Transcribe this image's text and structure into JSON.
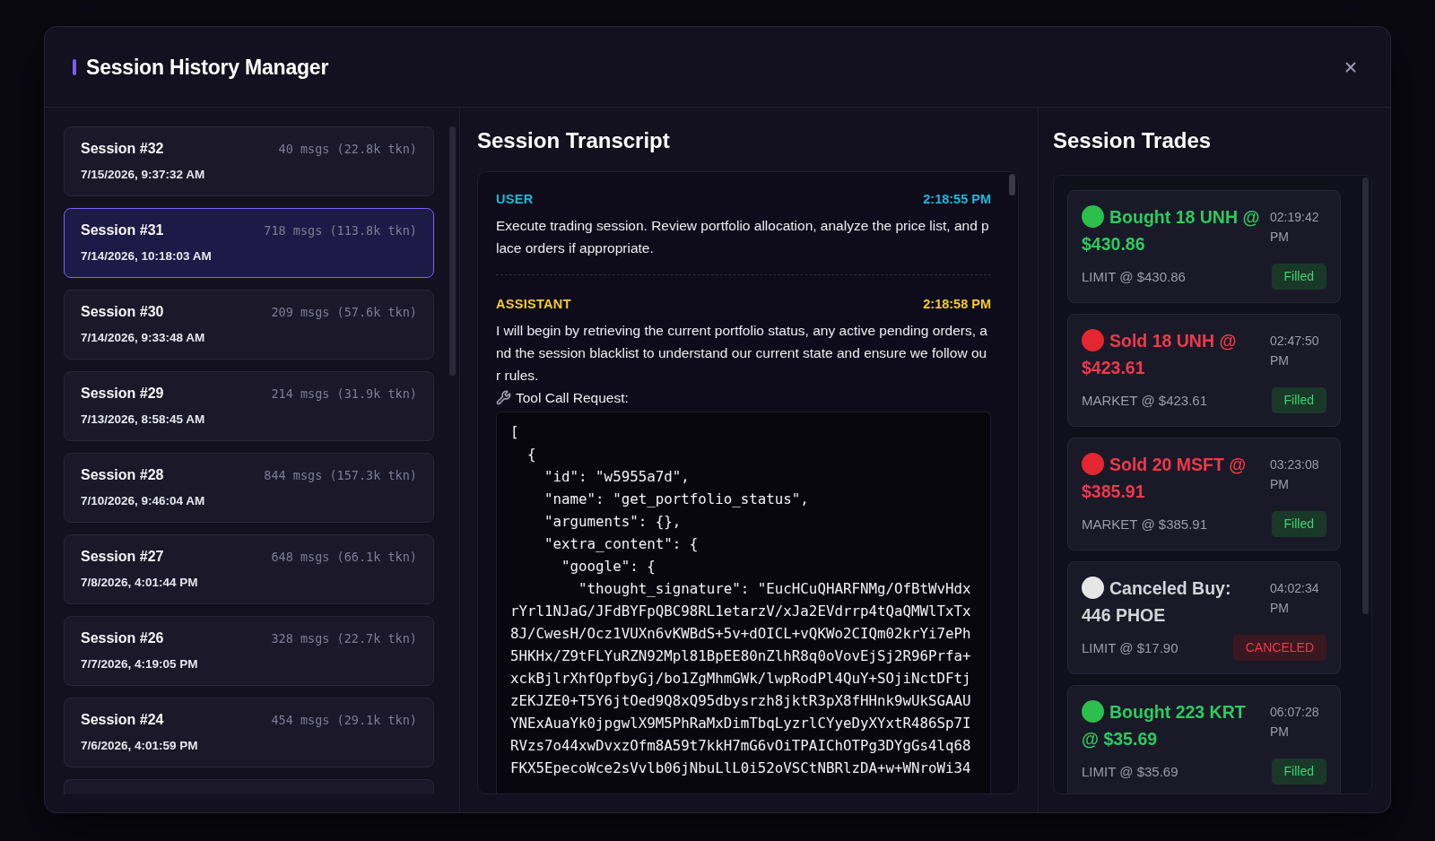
{
  "dialog": {
    "title": "Session History Manager"
  },
  "sessions": [
    {
      "title": "Session #32",
      "stats": "40 msgs (22.8k tkn)",
      "date": "7/15/2026, 9:37:32 AM",
      "selected": false
    },
    {
      "title": "Session #31",
      "stats": "718 msgs (113.8k tkn)",
      "date": "7/14/2026, 10:18:03 AM",
      "selected": true
    },
    {
      "title": "Session #30",
      "stats": "209 msgs (57.6k tkn)",
      "date": "7/14/2026, 9:33:48 AM",
      "selected": false
    },
    {
      "title": "Session #29",
      "stats": "214 msgs (31.9k tkn)",
      "date": "7/13/2026, 8:58:45 AM",
      "selected": false
    },
    {
      "title": "Session #28",
      "stats": "844 msgs (157.3k tkn)",
      "date": "7/10/2026, 9:46:04 AM",
      "selected": false
    },
    {
      "title": "Session #27",
      "stats": "648 msgs (66.1k tkn)",
      "date": "7/8/2026, 4:01:44 PM",
      "selected": false
    },
    {
      "title": "Session #26",
      "stats": "328 msgs (22.7k tkn)",
      "date": "7/7/2026, 4:19:05 PM",
      "selected": false
    },
    {
      "title": "Session #24",
      "stats": "454 msgs (29.1k tkn)",
      "date": "7/6/2026, 4:01:59 PM",
      "selected": false
    },
    {
      "selected": false
    }
  ],
  "transcript": {
    "heading": "Session Transcript",
    "messages": [
      {
        "kind": "user",
        "role": "USER",
        "time": "2:18:55 PM",
        "text": "Execute trading session. Review portfolio allocation, analyze the price list, and place orders if appropriate."
      },
      {
        "kind": "assistant",
        "role": "ASSISTANT",
        "time": "2:18:58 PM",
        "text": "I will begin by retrieving the current portfolio status, any active pending orders, and the session blacklist to understand our current state and ensure we follow our rules.",
        "tool_call": {
          "label": "Tool Call Request:",
          "code_lines": [
            "[",
            "  {",
            "    \"id\": \"w5955a7d\",",
            "    \"name\": \"get_portfolio_status\",",
            "    \"arguments\": {},",
            "    \"extra_content\": {",
            "      \"google\": {",
            "        \"thought_signature\": \"EucHCuQHARFNMg/OfBtWvHdx",
            "rYrl1NJaG/JFdBYFpQBC98RL1etarzV/xJa2EVdrrp4tQaQMWlTxTx",
            "8J/CwesH/Ocz1VUXn6vKWBdS+5v+dOICL+vQKWo2CIQm02krYi7ePh",
            "5HKHx/Z9tFLYuRZN92Mpl81BpEE80nZlhR8q0oVovEjSj2R96Prfa+",
            "xckBjlrXhfOpfbyGj/bo1ZgMhmGWk/lwpRodPl4QuY+SOjiNctDFtj",
            "zEKJZE0+T5Y6jtOed9Q8xQ95dbysrzh8jktR3pX8fHHnk9wUkSGAAU",
            "YNExAuaYk0jpgwlX9M5PhRaMxDimTbqLyzrlCYyeDyXYxtR486Sp7I",
            "RVzs7o44xwDvxzOfm8A59t7kkH7mG6vOiTPAIChOTPg3DYgGs4lq68",
            "FKX5EpecoWce2sVvlb06jNbuLlL0i52oVSCtNBRlzDA+w+WNroWi34"
          ]
        }
      }
    ]
  },
  "trades": {
    "heading": "Session Trades",
    "items": [
      {
        "kind": "buy",
        "color": "#2bbf4c",
        "title": "Bought 18 UNH @ $430.86",
        "time": "02:19:42 PM",
        "order": "LIMIT @ $430.86",
        "status": {
          "kind": "filled",
          "label": "Filled"
        }
      },
      {
        "kind": "sell",
        "color": "#e3262f",
        "title": "Sold 18 UNH @ $423.61",
        "time": "02:47:50 PM",
        "order": "MARKET @ $423.61",
        "status": {
          "kind": "filled",
          "label": "Filled"
        }
      },
      {
        "kind": "sell",
        "color": "#e3262f",
        "title": "Sold 20 MSFT @ $385.91",
        "time": "03:23:08 PM",
        "order": "MARKET @ $385.91",
        "status": {
          "kind": "filled",
          "label": "Filled"
        }
      },
      {
        "kind": "canceled",
        "color": "#e6e6e6",
        "title": "Canceled Buy: 446 PHOE",
        "time": "04:02:34 PM",
        "order": "LIMIT @ $17.90",
        "status": {
          "kind": "canceled",
          "label": "CANCELED"
        }
      },
      {
        "kind": "buy",
        "color": "#2bbf4c",
        "title": "Bought 223 KRT @ $35.69",
        "time": "06:07:28 PM",
        "order": "LIMIT @ $35.69",
        "status": {
          "kind": "filled",
          "label": "Filled"
        }
      }
    ]
  }
}
